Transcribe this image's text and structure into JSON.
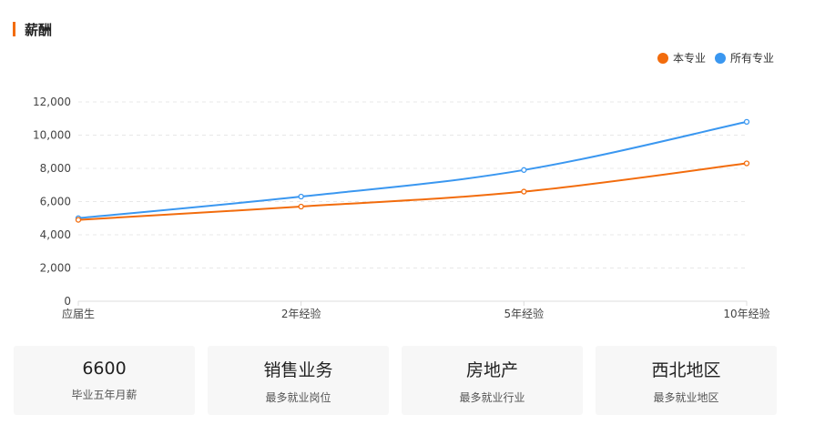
{
  "section": {
    "title": "薪酬"
  },
  "legend": [
    {
      "name": "本专业",
      "color": "#f26c0d"
    },
    {
      "name": "所有专业",
      "color": "#3a97f0"
    }
  ],
  "chart_data": {
    "type": "line",
    "categories": [
      "应届生",
      "2年经验",
      "5年经验",
      "10年经验"
    ],
    "series": [
      {
        "name": "本专业",
        "color": "#f26c0d",
        "values": [
          4900,
          5700,
          6600,
          8300
        ]
      },
      {
        "name": "所有专业",
        "color": "#3a97f0",
        "values": [
          5000,
          6300,
          7900,
          10800
        ]
      }
    ],
    "ylim": [
      0,
      12000
    ],
    "yticks": [
      "0",
      "2,000",
      "4,000",
      "6,000",
      "8,000",
      "10,000",
      "12,000"
    ],
    "grid": true,
    "legend_position": "top-right"
  },
  "cards": [
    {
      "value": "6600",
      "label": "毕业五年月薪"
    },
    {
      "value": "销售业务",
      "label": "最多就业岗位"
    },
    {
      "value": "房地产",
      "label": "最多就业行业"
    },
    {
      "value": "西北地区",
      "label": "最多就业地区"
    }
  ]
}
